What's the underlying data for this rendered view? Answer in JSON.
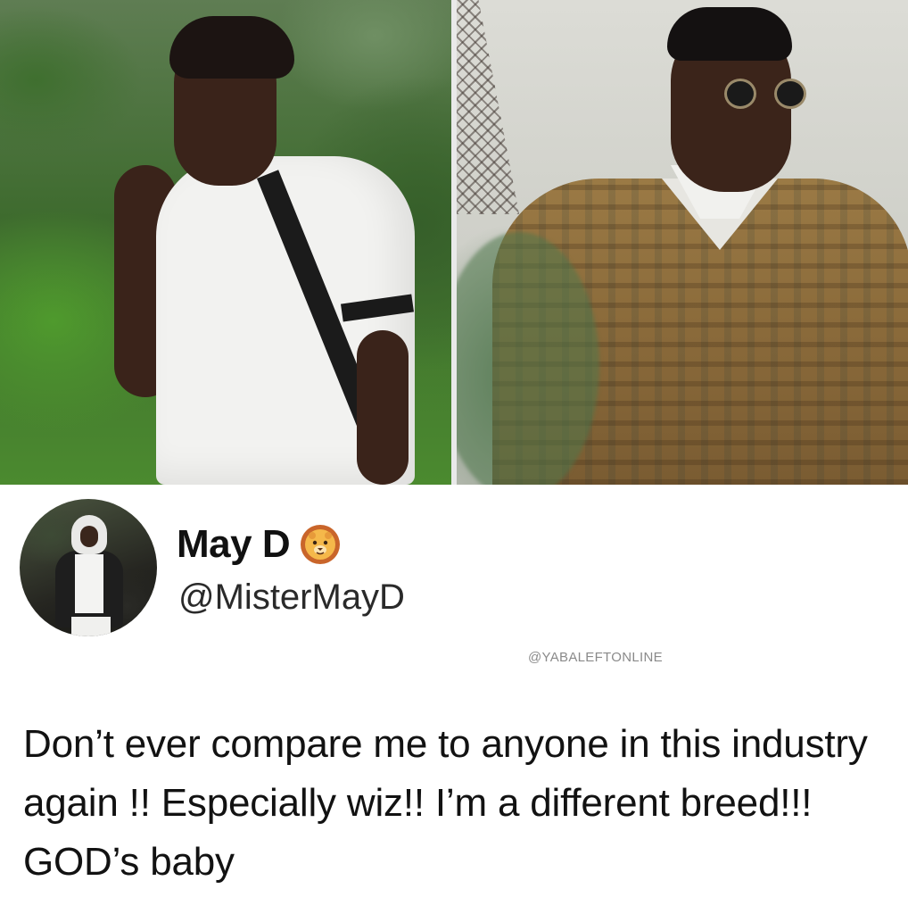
{
  "photos": {
    "left": {
      "alt": "Man in white t-shirt with black crossbody strap"
    },
    "right": {
      "alt": "Man in patterned brown sweater and round sunglasses"
    }
  },
  "tweet": {
    "display_name": "May D",
    "badge_icon": "lion-face-icon",
    "handle": "@MisterMayD",
    "watermark": "@YABALEFTONLINE",
    "text": "Don’t ever compare me to anyone in this industry again !! Especially wiz!! I’m a different breed!!! GOD’s baby"
  },
  "colors": {
    "text": "#111111",
    "handle": "#2a2a2a",
    "watermark": "#8a8a8a",
    "background": "#ffffff"
  }
}
